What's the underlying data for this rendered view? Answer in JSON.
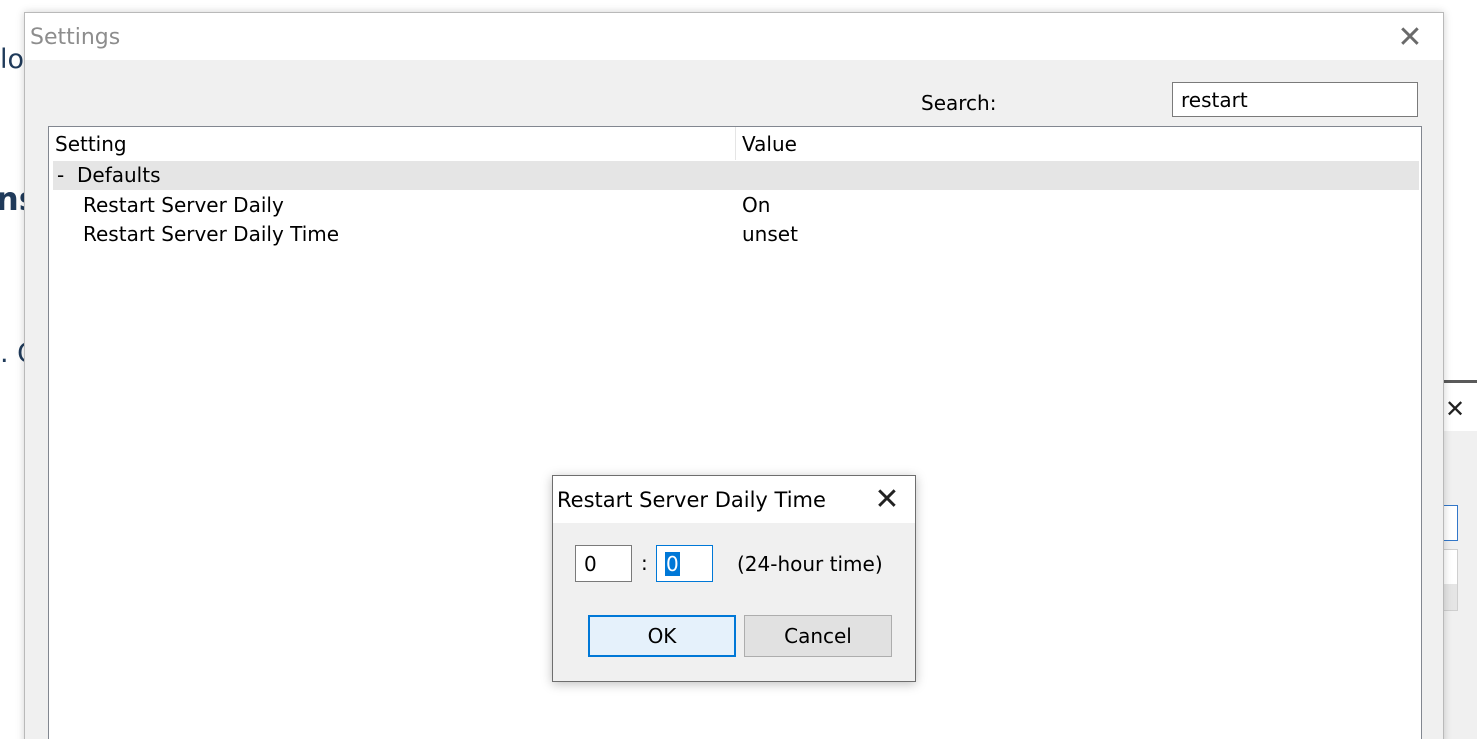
{
  "background": {
    "fragments": [
      "lo",
      "ns",
      ". C"
    ]
  },
  "settings_window": {
    "title": "Settings",
    "close_glyph": "✕",
    "search": {
      "label": "Search:",
      "value": "restart"
    },
    "grid": {
      "columns": [
        "Setting",
        "Value"
      ],
      "group": {
        "toggle": "-",
        "label": "Defaults"
      },
      "rows": [
        {
          "name": "Restart Server Daily",
          "value": "On"
        },
        {
          "name": "Restart Server Daily Time",
          "value": "unset"
        }
      ]
    }
  },
  "dialog": {
    "title": "Restart Server Daily Time",
    "close_glyph": "✕",
    "hour_value": "0",
    "colon": ":",
    "minute_value": "0",
    "hint": "(24-hour time)",
    "ok_label": "OK",
    "cancel_label": "Cancel"
  },
  "side_window": {
    "close_glyph": "✕"
  },
  "colors": {
    "accent": "#0078d7",
    "window_bg": "#f0f0f0",
    "group_row_bg": "#e5e5e5"
  }
}
